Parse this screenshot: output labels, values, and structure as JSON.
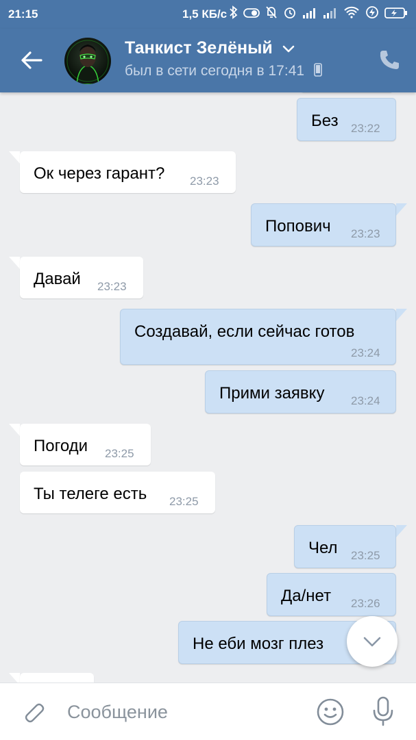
{
  "status_bar": {
    "time": "21:15",
    "network_speed": "1,5 КБ/с",
    "icons": [
      "bluetooth-icon",
      "toggle-icon",
      "mute-icon",
      "alarm-icon",
      "signal-icon",
      "signal-icon",
      "wifi-icon",
      "charging-icon",
      "battery-icon"
    ]
  },
  "header": {
    "contact_name": "Танкист Зелёный",
    "last_seen": "был в сети сегодня в 17:41",
    "back_icon": "back-arrow-icon",
    "call_icon": "phone-icon",
    "color": "#4a76a8"
  },
  "messages": [
    {
      "dir": "out",
      "text": "Без",
      "time": "23:22"
    },
    {
      "dir": "in",
      "text": "Ок через гарант?",
      "time": "23:23"
    },
    {
      "dir": "out",
      "text": "Попович",
      "time": "23:23"
    },
    {
      "dir": "in",
      "text": "Давай",
      "time": "23:23"
    },
    {
      "dir": "out",
      "text": "Создавай, если сейчас готов",
      "time": "23:24"
    },
    {
      "dir": "out",
      "text": "Прими заявку",
      "time": "23:24"
    },
    {
      "dir": "in",
      "text": "Погоди",
      "time": "23:25"
    },
    {
      "dir": "in",
      "text": "Ты телеге есть",
      "time": "23:25"
    },
    {
      "dir": "out",
      "text": "Чел",
      "time": "23:25"
    },
    {
      "dir": "out",
      "text": "Да/нет",
      "time": "23:26"
    },
    {
      "dir": "out",
      "text": "Не еби мозг плез",
      "time": ""
    }
  ],
  "input_bar": {
    "placeholder": "Сообщение",
    "value": "",
    "icons": [
      "paperclip-icon",
      "emoji-icon",
      "microphone-icon"
    ]
  },
  "colors": {
    "incoming_bubble": "#ffffff",
    "outgoing_bubble": "#cce0f5",
    "background": "#edeef0",
    "time_text": "#8e9aa8"
  }
}
